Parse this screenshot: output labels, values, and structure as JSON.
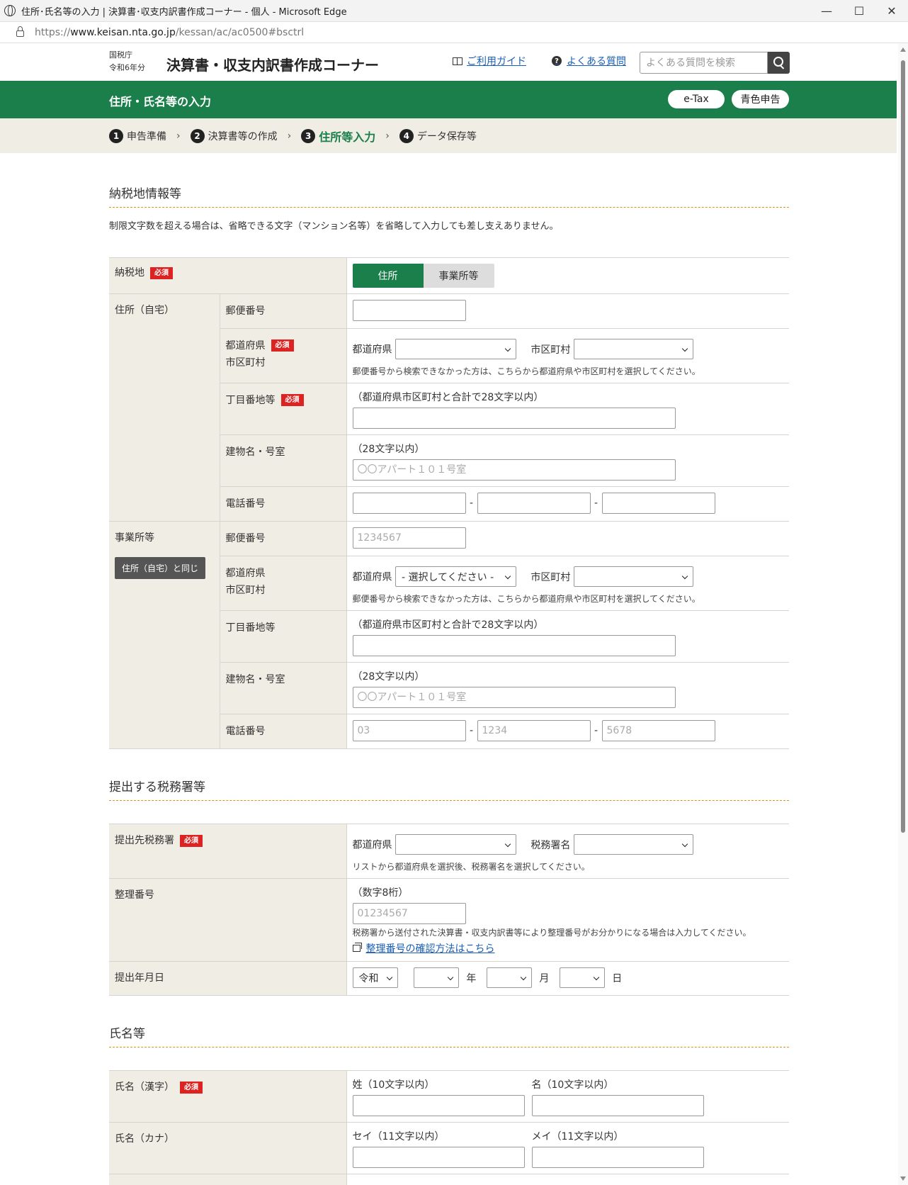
{
  "browser": {
    "window_title": "住所･氏名等の入力 | 決算書･収支内訳書作成コーナー - 個人 - Microsoft Edge",
    "url_prefix": "https://",
    "url_host": "www.keisan.nta.go.jp",
    "url_path": "/kessan/ac/ac0500#bsctrl",
    "controls": [
      "—",
      "☐",
      "✕"
    ]
  },
  "header": {
    "agency": "国税庁",
    "year": "令和6年分",
    "site_title": "決算書・収支内訳書作成コーナー",
    "guide_link": "ご利用ガイド",
    "faq_link": "よくある質問",
    "faq_icon": "?",
    "search_placeholder": "よくある質問を検索"
  },
  "page_bar": {
    "title": "住所・氏名等の入力",
    "etax": "e-Tax",
    "blue": "青色申告"
  },
  "steps": [
    {
      "num": "1",
      "label": "申告準備"
    },
    {
      "num": "2",
      "label": "決算書等の作成"
    },
    {
      "num": "3",
      "label": "住所等入力"
    },
    {
      "num": "4",
      "label": "データ保存等"
    }
  ],
  "step_sep": "›",
  "required": "必須",
  "s1": {
    "title": "納税地情報等",
    "note": "制限文字数を超える場合は、省略できる文字（マンション名等）を省略して入力しても差し支えありません。",
    "nouzeichi": "納税地",
    "toggle_on": "住所",
    "toggle_off": "事業所等",
    "home": {
      "label": "住所（自宅）",
      "postal": "郵便番号",
      "pref_city_1": "都道府県",
      "pref_city_2": "市区町村",
      "pref": "都道府県",
      "city": "市区町村",
      "pref_value": "",
      "hint": "郵便番号から検索できなかった方は、こちらから都道府県や市区町村を選択してください。",
      "chome": "丁目番地等",
      "chome_note": "（都道府県市区町村と合計で28文字以内）",
      "bldg": "建物名・号室",
      "bldg_note": "（28文字以内）",
      "bldg_placeholder": "〇〇アパート１０１号室",
      "tel": "電話番号",
      "dash": "-"
    },
    "office": {
      "label": "事業所等",
      "same_btn": "住所（自宅）と同じ",
      "postal": "郵便番号",
      "postal_placeholder": "1234567",
      "pref_city_1": "都道府県",
      "pref_city_2": "市区町村",
      "pref": "都道府県",
      "pref_value": "- 選択してください -",
      "city": "市区町村",
      "hint": "郵便番号から検索できなかった方は、こちらから都道府県や市区町村を選択してください。",
      "chome": "丁目番地等",
      "chome_note": "（都道府県市区町村と合計で28文字以内）",
      "bldg": "建物名・号室",
      "bldg_note": "（28文字以内）",
      "bldg_placeholder": "〇〇アパート１０１号室",
      "tel": "電話番号",
      "tel1_placeholder": "03",
      "tel2_placeholder": "1234",
      "tel3_placeholder": "5678",
      "dash": "-"
    }
  },
  "s2": {
    "title": "提出する税務署等",
    "office": "提出先税務署",
    "pref": "都道府県",
    "taxoffice": "税務署名",
    "office_hint": "リストから都道府県を選択後、税務署名を選択してください。",
    "seiri": "整理番号",
    "seiri_note": "（数字8桁）",
    "seiri_placeholder": "01234567",
    "seiri_hint": "税務署から送付された決算書・収支内訳書等により整理番号がお分かりになる場合は入力してください。",
    "seiri_link": "整理番号の確認方法はこちら",
    "date": "提出年月日",
    "era": "令和",
    "year": "年",
    "month": "月",
    "day": "日"
  },
  "s3": {
    "title": "氏名等",
    "kanji": "氏名（漢字）",
    "sei": "姓（10文字以内）",
    "mei": "名（10文字以内）",
    "kana": "氏名（カナ）",
    "sei_kana": "セイ（11文字以内）",
    "mei_kana": "メイ（11文字以内）"
  },
  "colors": {
    "brand_green": "#1a7f4a",
    "required_red": "#dd2222",
    "label_bg": "#efede4",
    "link_blue": "#1a5fb4"
  }
}
